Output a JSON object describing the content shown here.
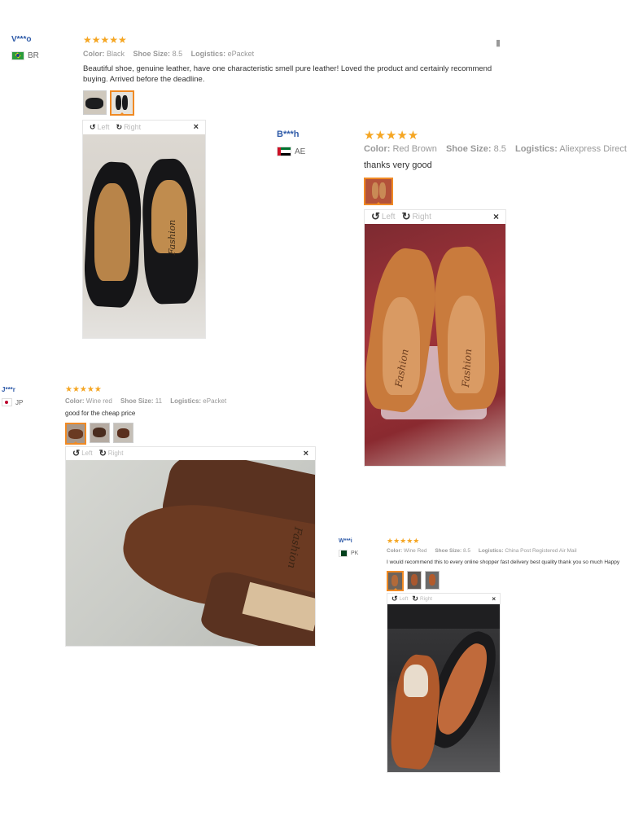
{
  "reviews": [
    {
      "user": "V***o",
      "country": "BR",
      "stars": "★★★★★",
      "color_label": "Color:",
      "color_value": "Black",
      "size_label": "Shoe Size:",
      "size_value": "8.5",
      "logistics_label": "Logistics:",
      "logistics_value": "ePacket",
      "text": "Beautiful shoe, genuine leather, have one characteristic smell pure leather! Loved the product and certainly recommend buying. Arrived before the deadline.",
      "viewer": {
        "left": "Left",
        "right": "Right",
        "close": "×"
      }
    },
    {
      "user": "B***h",
      "country": "AE",
      "stars": "★★★★★",
      "color_label": "Color:",
      "color_value": "Red Brown",
      "size_label": "Shoe Size:",
      "size_value": "8.5",
      "logistics_label": "Logistics:",
      "logistics_value": "Aliexpress Direct",
      "text": "thanks very good",
      "viewer": {
        "left": "Left",
        "right": "Right",
        "close": "×"
      }
    },
    {
      "user": "J***r",
      "country": "JP",
      "stars": "★★★★★",
      "color_label": "Color:",
      "color_value": "Wine red",
      "size_label": "Shoe Size:",
      "size_value": "11",
      "logistics_label": "Logistics:",
      "logistics_value": "ePacket",
      "text": "good for the cheap price",
      "viewer": {
        "left": "Left",
        "right": "Right",
        "close": "×"
      }
    },
    {
      "user": "W***i",
      "country": "PK",
      "stars": "★★★★★",
      "color_label": "Color:",
      "color_value": "Wine Red",
      "size_label": "Shoe Size:",
      "size_value": "8.5",
      "logistics_label": "Logistics:",
      "logistics_value": "China Post Registered Air Mail",
      "text": "I would recommend this to every online shopper fast delivery best quality thank you so much Happy",
      "viewer": {
        "left": "Left",
        "right": "Right",
        "close": "×"
      }
    }
  ],
  "icons": {
    "star": "star-icon",
    "rotate_left": "rotate-left-icon",
    "rotate_right": "rotate-right-icon",
    "close": "close-icon",
    "report": "flag-report-icon"
  },
  "colors": {
    "username": "#2e5aa8",
    "stars": "#f5a623",
    "selected_thumb": "#f08a24"
  }
}
